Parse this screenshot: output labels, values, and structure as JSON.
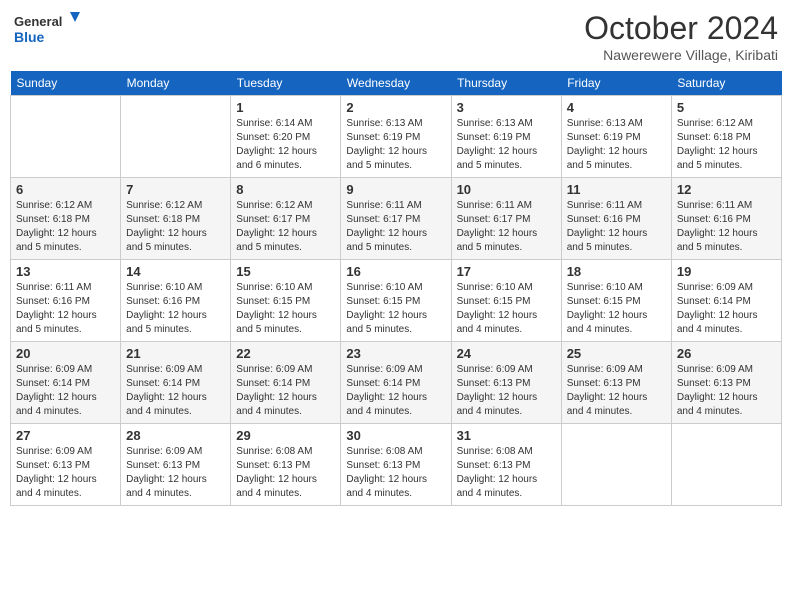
{
  "header": {
    "logo_line1": "General",
    "logo_line2": "Blue",
    "month": "October 2024",
    "location": "Nawerewere Village, Kiribati"
  },
  "weekdays": [
    "Sunday",
    "Monday",
    "Tuesday",
    "Wednesday",
    "Thursday",
    "Friday",
    "Saturday"
  ],
  "weeks": [
    [
      {
        "day": "",
        "info": ""
      },
      {
        "day": "",
        "info": ""
      },
      {
        "day": "1",
        "info": "Sunrise: 6:14 AM\nSunset: 6:20 PM\nDaylight: 12 hours and 6 minutes."
      },
      {
        "day": "2",
        "info": "Sunrise: 6:13 AM\nSunset: 6:19 PM\nDaylight: 12 hours and 5 minutes."
      },
      {
        "day": "3",
        "info": "Sunrise: 6:13 AM\nSunset: 6:19 PM\nDaylight: 12 hours and 5 minutes."
      },
      {
        "day": "4",
        "info": "Sunrise: 6:13 AM\nSunset: 6:19 PM\nDaylight: 12 hours and 5 minutes."
      },
      {
        "day": "5",
        "info": "Sunrise: 6:12 AM\nSunset: 6:18 PM\nDaylight: 12 hours and 5 minutes."
      }
    ],
    [
      {
        "day": "6",
        "info": "Sunrise: 6:12 AM\nSunset: 6:18 PM\nDaylight: 12 hours and 5 minutes."
      },
      {
        "day": "7",
        "info": "Sunrise: 6:12 AM\nSunset: 6:18 PM\nDaylight: 12 hours and 5 minutes."
      },
      {
        "day": "8",
        "info": "Sunrise: 6:12 AM\nSunset: 6:17 PM\nDaylight: 12 hours and 5 minutes."
      },
      {
        "day": "9",
        "info": "Sunrise: 6:11 AM\nSunset: 6:17 PM\nDaylight: 12 hours and 5 minutes."
      },
      {
        "day": "10",
        "info": "Sunrise: 6:11 AM\nSunset: 6:17 PM\nDaylight: 12 hours and 5 minutes."
      },
      {
        "day": "11",
        "info": "Sunrise: 6:11 AM\nSunset: 6:16 PM\nDaylight: 12 hours and 5 minutes."
      },
      {
        "day": "12",
        "info": "Sunrise: 6:11 AM\nSunset: 6:16 PM\nDaylight: 12 hours and 5 minutes."
      }
    ],
    [
      {
        "day": "13",
        "info": "Sunrise: 6:11 AM\nSunset: 6:16 PM\nDaylight: 12 hours and 5 minutes."
      },
      {
        "day": "14",
        "info": "Sunrise: 6:10 AM\nSunset: 6:16 PM\nDaylight: 12 hours and 5 minutes."
      },
      {
        "day": "15",
        "info": "Sunrise: 6:10 AM\nSunset: 6:15 PM\nDaylight: 12 hours and 5 minutes."
      },
      {
        "day": "16",
        "info": "Sunrise: 6:10 AM\nSunset: 6:15 PM\nDaylight: 12 hours and 5 minutes."
      },
      {
        "day": "17",
        "info": "Sunrise: 6:10 AM\nSunset: 6:15 PM\nDaylight: 12 hours and 4 minutes."
      },
      {
        "day": "18",
        "info": "Sunrise: 6:10 AM\nSunset: 6:15 PM\nDaylight: 12 hours and 4 minutes."
      },
      {
        "day": "19",
        "info": "Sunrise: 6:09 AM\nSunset: 6:14 PM\nDaylight: 12 hours and 4 minutes."
      }
    ],
    [
      {
        "day": "20",
        "info": "Sunrise: 6:09 AM\nSunset: 6:14 PM\nDaylight: 12 hours and 4 minutes."
      },
      {
        "day": "21",
        "info": "Sunrise: 6:09 AM\nSunset: 6:14 PM\nDaylight: 12 hours and 4 minutes."
      },
      {
        "day": "22",
        "info": "Sunrise: 6:09 AM\nSunset: 6:14 PM\nDaylight: 12 hours and 4 minutes."
      },
      {
        "day": "23",
        "info": "Sunrise: 6:09 AM\nSunset: 6:14 PM\nDaylight: 12 hours and 4 minutes."
      },
      {
        "day": "24",
        "info": "Sunrise: 6:09 AM\nSunset: 6:13 PM\nDaylight: 12 hours and 4 minutes."
      },
      {
        "day": "25",
        "info": "Sunrise: 6:09 AM\nSunset: 6:13 PM\nDaylight: 12 hours and 4 minutes."
      },
      {
        "day": "26",
        "info": "Sunrise: 6:09 AM\nSunset: 6:13 PM\nDaylight: 12 hours and 4 minutes."
      }
    ],
    [
      {
        "day": "27",
        "info": "Sunrise: 6:09 AM\nSunset: 6:13 PM\nDaylight: 12 hours and 4 minutes."
      },
      {
        "day": "28",
        "info": "Sunrise: 6:09 AM\nSunset: 6:13 PM\nDaylight: 12 hours and 4 minutes."
      },
      {
        "day": "29",
        "info": "Sunrise: 6:08 AM\nSunset: 6:13 PM\nDaylight: 12 hours and 4 minutes."
      },
      {
        "day": "30",
        "info": "Sunrise: 6:08 AM\nSunset: 6:13 PM\nDaylight: 12 hours and 4 minutes."
      },
      {
        "day": "31",
        "info": "Sunrise: 6:08 AM\nSunset: 6:13 PM\nDaylight: 12 hours and 4 minutes."
      },
      {
        "day": "",
        "info": ""
      },
      {
        "day": "",
        "info": ""
      }
    ]
  ]
}
